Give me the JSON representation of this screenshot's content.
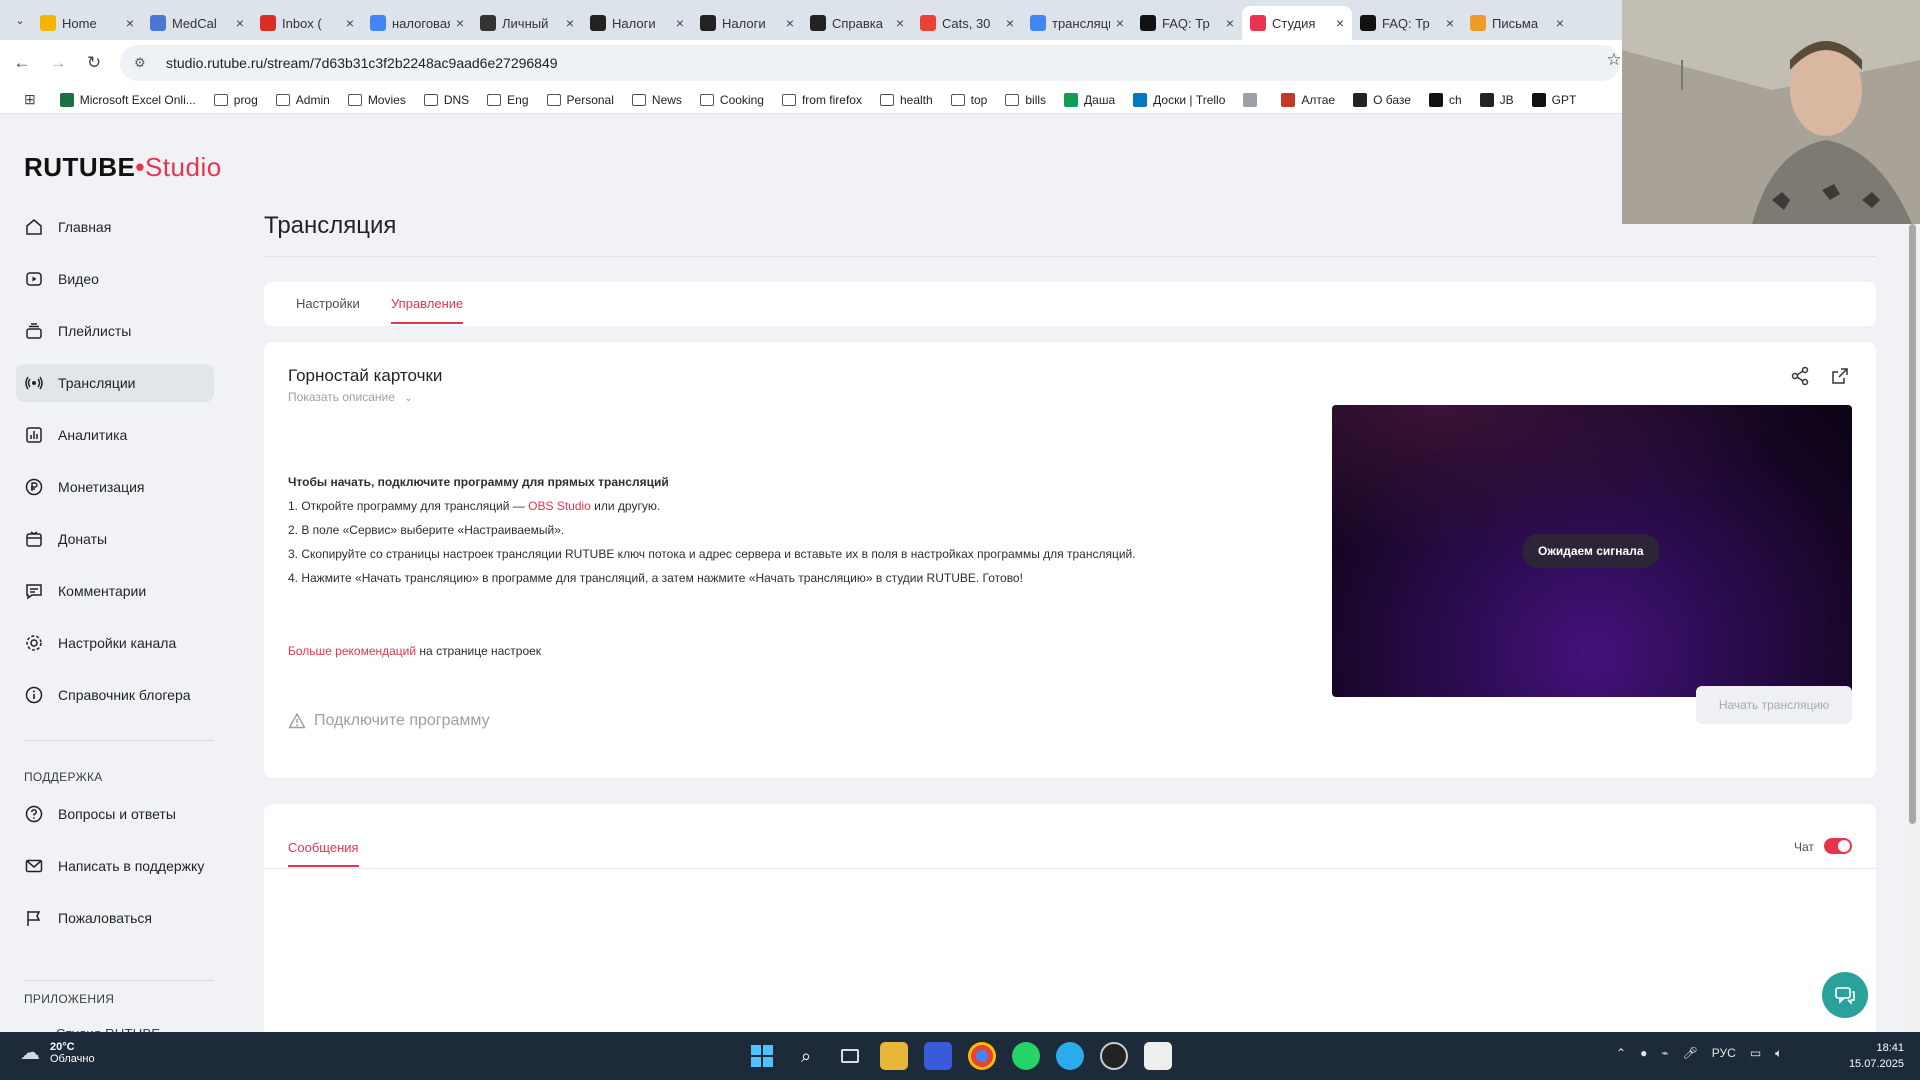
{
  "browser": {
    "tabs": [
      {
        "title": "Home",
        "color": "#f4b400",
        "icon": "google-drive-icon"
      },
      {
        "title": "MedCal",
        "color": "#4a77d4",
        "icon": "docs-icon"
      },
      {
        "title": "Inbox (",
        "color": "#d93025",
        "icon": "gmail-icon"
      },
      {
        "title": "налоговая",
        "color": "#4285f4",
        "icon": "google-icon"
      },
      {
        "title": "Личный",
        "color": "#333333",
        "icon": "nalog-icon"
      },
      {
        "title": "Налоги",
        "color": "#222222",
        "icon": "nalog-icon"
      },
      {
        "title": "Налоги",
        "color": "#222222",
        "icon": "nalog-icon"
      },
      {
        "title": "Справка",
        "color": "#222222",
        "icon": "nalog-icon"
      },
      {
        "title": "Cats, 30",
        "color": "#ea4335",
        "icon": "cats-icon"
      },
      {
        "title": "трансляция",
        "color": "#4285f4",
        "icon": "google-icon"
      },
      {
        "title": "FAQ: Тр",
        "color": "#111111",
        "icon": "rutube-icon"
      },
      {
        "title": "Студия",
        "color": "#e8344e",
        "icon": "rutube-studio-icon",
        "active": true
      },
      {
        "title": "FAQ: Тр",
        "color": "#111111",
        "icon": "rutube-icon"
      },
      {
        "title": "Письма",
        "color": "#f09a28",
        "icon": "mail-icon"
      }
    ],
    "url": "studio.rutube.ru/stream/7d63b31c3f2b2248ac9aad6e27296849",
    "bookmarks": [
      {
        "label": "",
        "type": "apps"
      },
      {
        "label": "Microsoft Excel Onli...",
        "type": "excel",
        "color": "#1d6f42"
      },
      {
        "label": "prog",
        "type": "folder"
      },
      {
        "label": "Admin",
        "type": "folder"
      },
      {
        "label": "Movies",
        "type": "folder"
      },
      {
        "label": "DNS",
        "type": "folder"
      },
      {
        "label": "Eng",
        "type": "folder"
      },
      {
        "label": "Personal",
        "type": "folder"
      },
      {
        "label": "News",
        "type": "folder"
      },
      {
        "label": "Cooking",
        "type": "folder"
      },
      {
        "label": "from firefox",
        "type": "folder"
      },
      {
        "label": "health",
        "type": "folder"
      },
      {
        "label": "top",
        "type": "folder"
      },
      {
        "label": "bills",
        "type": "folder"
      },
      {
        "label": "Даша",
        "type": "sheets",
        "color": "#0f9d58"
      },
      {
        "label": "Доски | Trello",
        "type": "trello",
        "color": "#0079bf"
      },
      {
        "label": "",
        "type": "misc",
        "color": "#9aa0a6"
      },
      {
        "label": "Алтае",
        "type": "home",
        "color": "#c0392b"
      },
      {
        "label": "О базе",
        "type": "globe",
        "color": "#222222"
      },
      {
        "label": "ch",
        "type": "gpt",
        "color": "#111111"
      },
      {
        "label": "JB",
        "type": "globe",
        "color": "#222222"
      },
      {
        "label": "GPT",
        "type": "gpt",
        "color": "#111111"
      }
    ]
  },
  "logo": {
    "main": "RUTUBE",
    "dot": "•",
    "studio": "Studio"
  },
  "sidebar": {
    "items": [
      {
        "label": "Главная",
        "icon": "home-icon"
      },
      {
        "label": "Видео",
        "icon": "video-icon"
      },
      {
        "label": "Плейлисты",
        "icon": "playlist-icon"
      },
      {
        "label": "Трансляции",
        "icon": "broadcast-icon",
        "selected": true
      },
      {
        "label": "Аналитика",
        "icon": "analytics-icon"
      },
      {
        "label": "Монетизация",
        "icon": "ruble-icon"
      },
      {
        "label": "Донаты",
        "icon": "donate-icon"
      },
      {
        "label": "Комментарии",
        "icon": "comments-icon"
      },
      {
        "label": "Настройки канала",
        "icon": "gear-icon"
      },
      {
        "label": "Справочник блогера",
        "icon": "info-icon"
      }
    ],
    "support_heading": "ПОДДЕРЖКА",
    "support_items": [
      {
        "label": "Вопросы и ответы",
        "icon": "question-icon"
      },
      {
        "label": "Написать в поддержку",
        "icon": "mail-icon"
      },
      {
        "label": "Пожаловаться",
        "icon": "flag-icon"
      }
    ],
    "apps_heading": "ПРИЛОЖЕНИЯ",
    "apps_partial": "Студия RUTUBE"
  },
  "main": {
    "page_title": "Трансляция",
    "tabs": [
      {
        "label": "Настройки"
      },
      {
        "label": "Управление",
        "active": true
      }
    ],
    "stream": {
      "title": "Горностай карточки",
      "show_description": "Показать описание",
      "instructions_heading": "Чтобы начать, подключите программу для прямых трансляций",
      "step1_prefix": "1. Откройте программу для трансляций — ",
      "step1_link": "OBS Studio",
      "step1_suffix": " или другую.",
      "step2": "2. В поле «Сервис» выберите «Настраиваемый».",
      "step3": "3. Скопируйте со страницы настроек трансляции RUTUBE ключ потока и адрес сервера и вставьте их в поля в настройках программы для трансляций.",
      "step4": "4. Нажмите «Начать трансляцию» в программе для трансляций, а затем нажмите «Начать трансляцию» в студии RUTUBE. Готово!",
      "more_link": "Больше рекомендаций",
      "more_suffix": " на странице настроек",
      "warning": "Подключите программу",
      "player_status": "Ожидаем сигнала",
      "start_button": "Начать трансляцию"
    },
    "messages": {
      "tab": "Сообщения",
      "chat_label": "Чат",
      "chat_enabled": true
    }
  },
  "taskbar": {
    "weather_temp": "20°C",
    "weather_desc": "Облачно",
    "lang": "РУС",
    "time": "18:41",
    "date": "15.07.2025"
  },
  "colors": {
    "accent": "#e8344e",
    "teal": "#2aa19a"
  }
}
